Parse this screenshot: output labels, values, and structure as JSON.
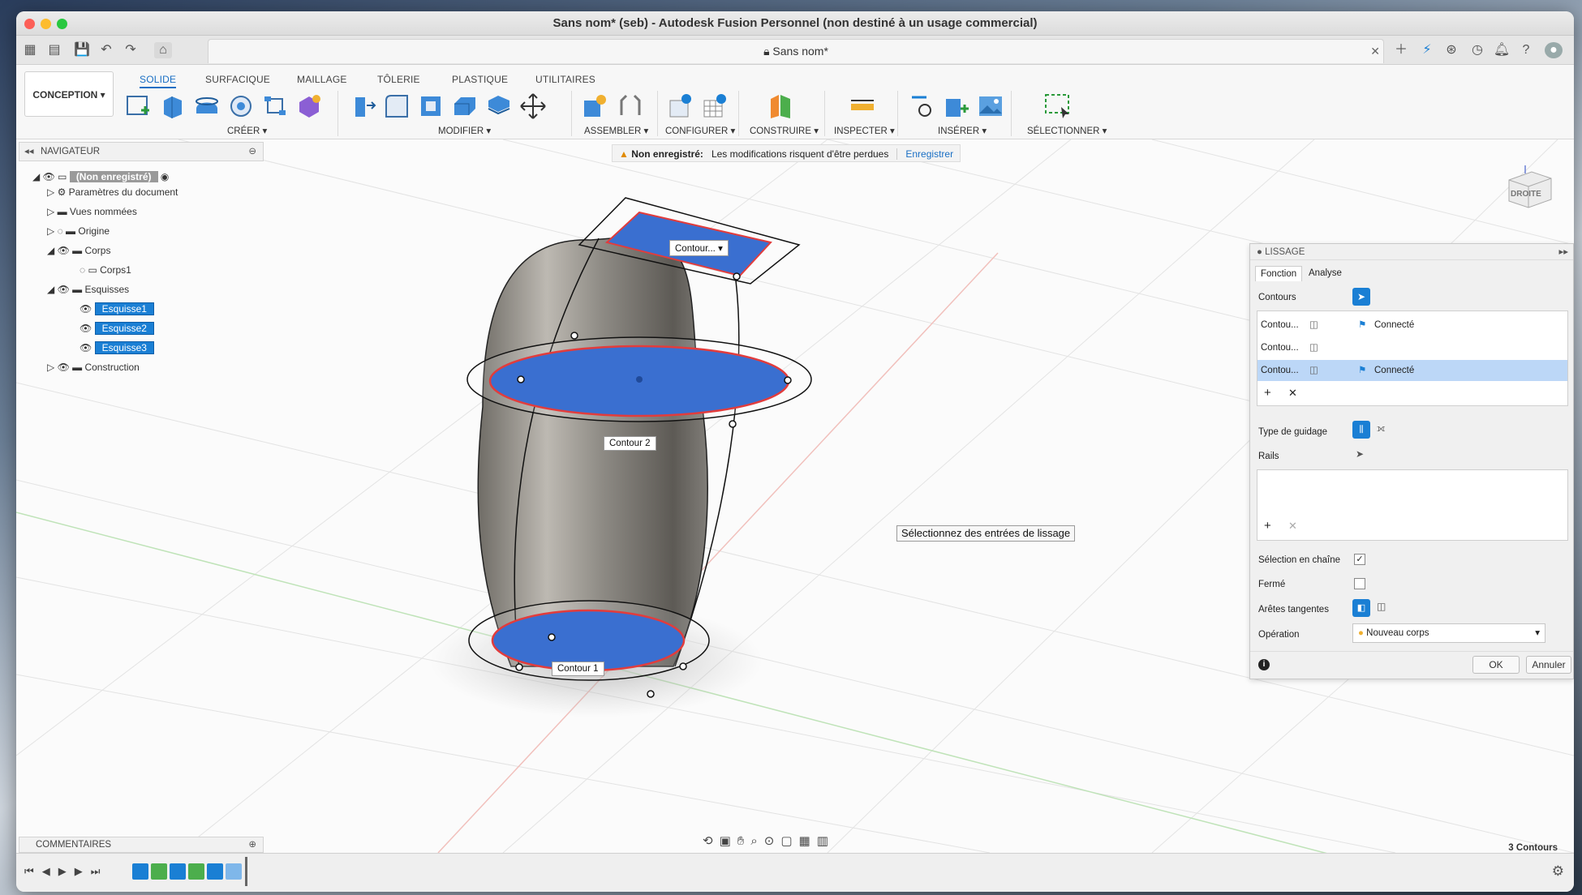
{
  "window": {
    "title": "Sans nom* (seb) - Autodesk Fusion Personnel (non destiné à un usage commercial)"
  },
  "document_tab": {
    "label": "Sans nom*"
  },
  "ribbon": {
    "workspace": "CONCEPTION",
    "tabs": [
      "SOLIDE",
      "SURFACIQUE",
      "MAILLAGE",
      "TÔLERIE",
      "PLASTIQUE",
      "UTILITAIRES"
    ],
    "groups": [
      "CRÉER",
      "MODIFIER",
      "ASSEMBLER",
      "CONFIGURER",
      "CONSTRUIRE",
      "INSPECTER",
      "INSÉRER",
      "SÉLECTIONNER"
    ]
  },
  "warning": {
    "label": "Non enregistré:",
    "message": "Les modifications risquent d'être perdues",
    "action": "Enregistrer"
  },
  "navigator": {
    "title": "NAVIGATEUR",
    "items": [
      {
        "label": "(Non enregistré)"
      },
      {
        "label": "Paramètres du document"
      },
      {
        "label": "Vues nommées"
      },
      {
        "label": "Origine"
      },
      {
        "label": "Corps"
      },
      {
        "label": "Corps1"
      },
      {
        "label": "Esquisses"
      },
      {
        "label": "Esquisse1"
      },
      {
        "label": "Esquisse2"
      },
      {
        "label": "Esquisse3"
      },
      {
        "label": "Construction"
      }
    ]
  },
  "viewcube": {
    "label": "DROITE"
  },
  "viewport_labels": {
    "contour_top": "Contour...",
    "contour2": "Contour 2",
    "contour1": "Contour 1"
  },
  "tooltip": "Sélectionnez des entrées de lissage",
  "loft_panel": {
    "title": "LISSAGE",
    "tabs": [
      "Fonction",
      "Analyse"
    ],
    "contours_label": "Contours",
    "rows": [
      {
        "name": "Contou...",
        "state": "Connecté"
      },
      {
        "name": "Contou...",
        "state": ""
      },
      {
        "name": "Contou...",
        "state": "Connecté"
      }
    ],
    "guide_type_label": "Type de guidage",
    "rails_label": "Rails",
    "chain_select_label": "Sélection en chaîne",
    "closed_label": "Fermé",
    "tangent_edges_label": "Arêtes tangentes",
    "operation_label": "Opération",
    "operation_value": "Nouveau corps",
    "ok": "OK",
    "cancel": "Annuler"
  },
  "comments": {
    "title": "COMMENTAIRES"
  },
  "status": {
    "count": "3 Contours"
  },
  "colors": {
    "accent": "#1a7fd4",
    "profile_fill": "#3a6fd0",
    "profile_edge": "#e23c3c"
  }
}
